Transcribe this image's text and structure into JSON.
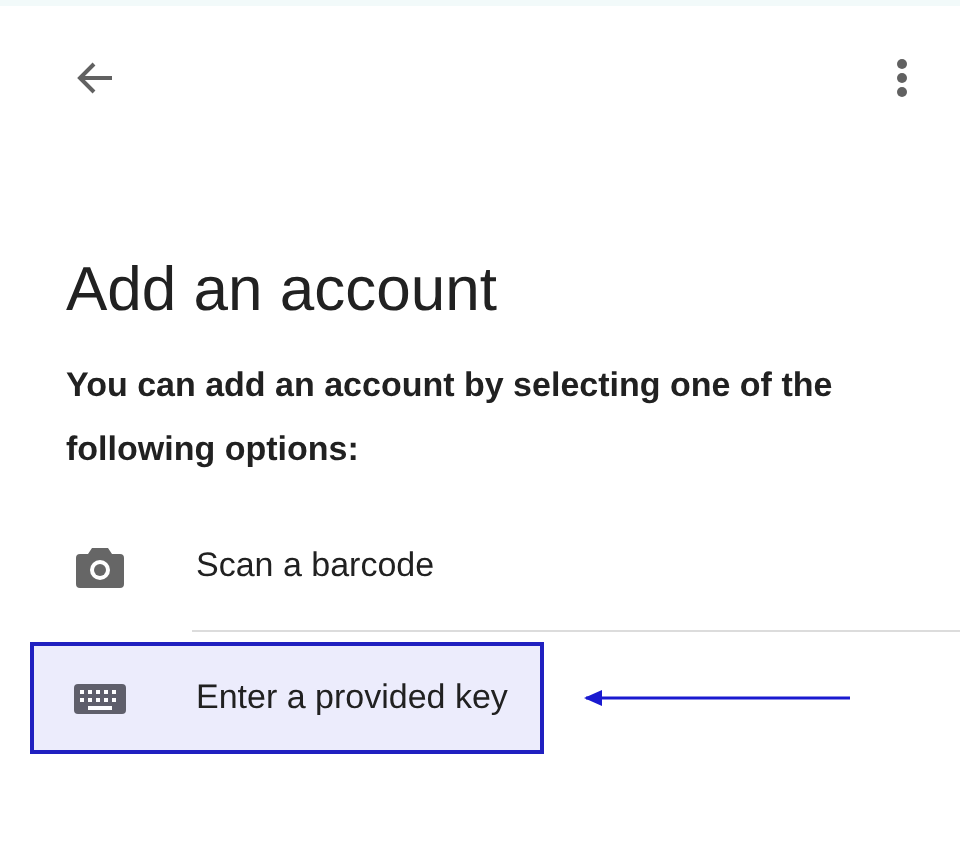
{
  "title": "Add an account",
  "description": "You can add an account by selecting one of the following options:",
  "options": [
    {
      "kind": "camera",
      "label": "Scan a barcode",
      "highlighted": false
    },
    {
      "kind": "keyboard",
      "label": "Enter a provided key",
      "highlighted": true
    }
  ]
}
